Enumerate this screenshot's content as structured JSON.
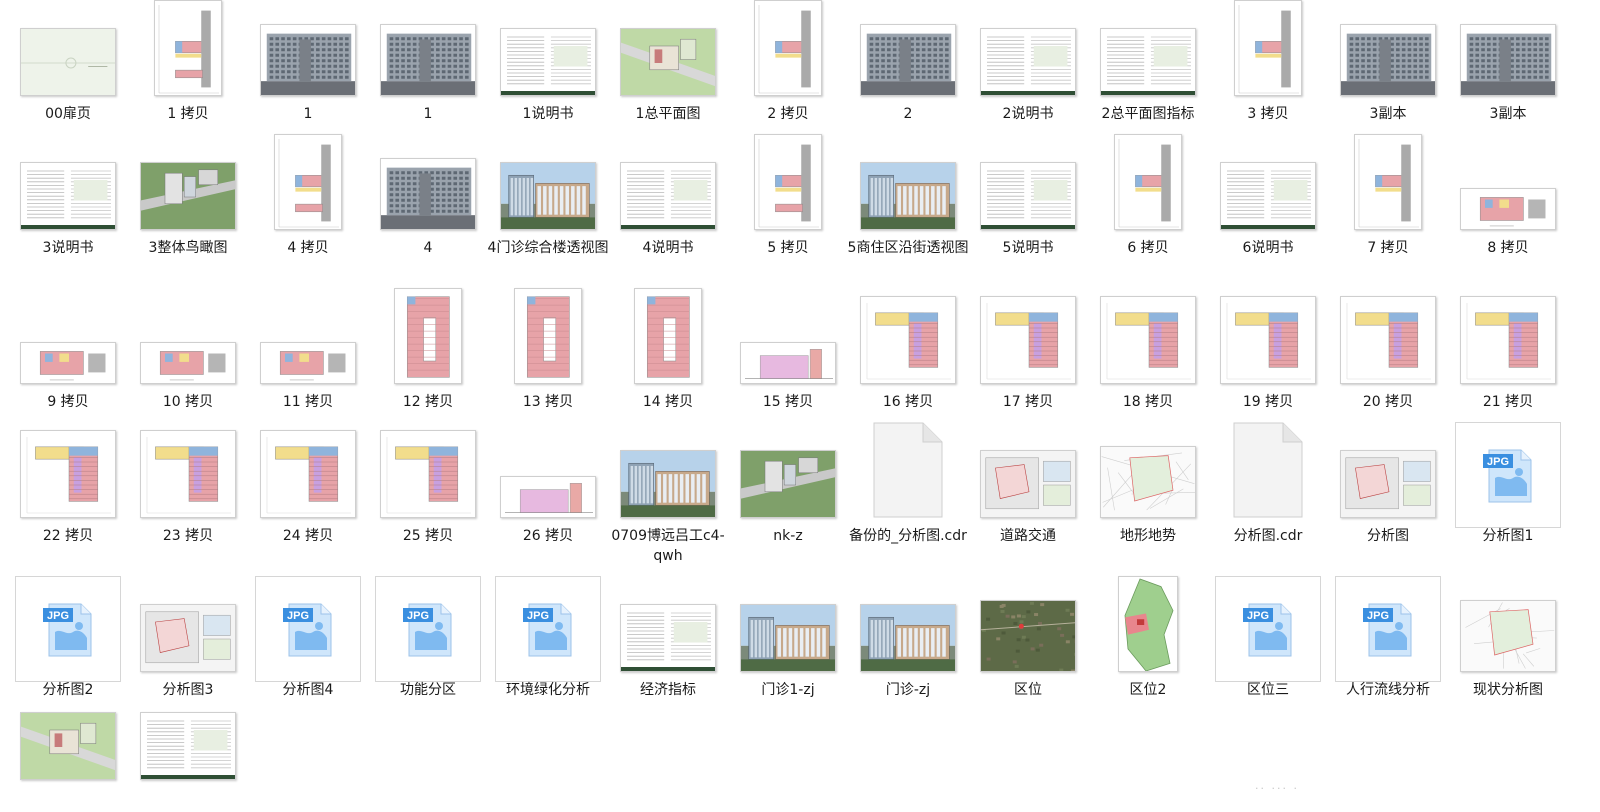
{
  "window": {
    "view": "large-icons"
  },
  "colors": {
    "jpg_blue": "#3a8fe0",
    "jpg_light": "#cfe6fb",
    "plan_pink": "#e7a3a8",
    "plan_yellow": "#f2dd8c",
    "grass": "#a9cf8c",
    "facade_gray": "#6b6f76"
  },
  "files": [
    {
      "label": "00扉页",
      "type": "cover"
    },
    {
      "label": "1 拷贝",
      "type": "plan-portrait"
    },
    {
      "label": "1",
      "type": "elevation"
    },
    {
      "label": "1",
      "type": "elevation"
    },
    {
      "label": "1说明书",
      "type": "doc"
    },
    {
      "label": "1总平面图",
      "type": "siteplan"
    },
    {
      "label": "2 拷贝",
      "type": "plan-portrait"
    },
    {
      "label": "2",
      "type": "elevation"
    },
    {
      "label": "2说明书",
      "type": "doc"
    },
    {
      "label": "2总平面图指标",
      "type": "doc"
    },
    {
      "label": "3 拷贝",
      "type": "plan-portrait"
    },
    {
      "label": "3副本",
      "type": "elevation"
    },
    {
      "label": "3副本",
      "type": "elevation"
    },
    {
      "label": "3说明书",
      "type": "doc"
    },
    {
      "label": "3整体鸟瞰图",
      "type": "aerial"
    },
    {
      "label": "4 拷贝",
      "type": "plan-portrait"
    },
    {
      "label": "4",
      "type": "elevation"
    },
    {
      "label": "4门诊综合楼透视图",
      "type": "render"
    },
    {
      "label": "4说明书",
      "type": "doc"
    },
    {
      "label": "5 拷贝",
      "type": "plan-portrait"
    },
    {
      "label": "5商住区沿街透视图",
      "type": "render"
    },
    {
      "label": "5说明书",
      "type": "doc"
    },
    {
      "label": "6 拷贝",
      "type": "plan-portrait"
    },
    {
      "label": "6说明书",
      "type": "doc"
    },
    {
      "label": "7 拷贝",
      "type": "plan-portrait"
    },
    {
      "label": "8 拷贝",
      "type": "plan-wide"
    },
    {
      "label": "9 拷贝",
      "type": "plan-wide"
    },
    {
      "label": "10 拷贝",
      "type": "plan-wide"
    },
    {
      "label": "11 拷贝",
      "type": "plan-wide"
    },
    {
      "label": "12 拷贝",
      "type": "plan-tall"
    },
    {
      "label": "13 拷贝",
      "type": "plan-tall"
    },
    {
      "label": "14 拷贝",
      "type": "plan-tall"
    },
    {
      "label": "15 拷贝",
      "type": "section"
    },
    {
      "label": "16 拷贝",
      "type": "plan-landscape"
    },
    {
      "label": "17 拷贝",
      "type": "plan-landscape"
    },
    {
      "label": "18 拷贝",
      "type": "plan-landscape"
    },
    {
      "label": "19 拷贝",
      "type": "plan-landscape"
    },
    {
      "label": "20 拷贝",
      "type": "plan-landscape"
    },
    {
      "label": "21 拷贝",
      "type": "plan-landscape"
    },
    {
      "label": "22 拷贝",
      "type": "plan-landscape"
    },
    {
      "label": "23 拷贝",
      "type": "plan-landscape"
    },
    {
      "label": "24 拷贝",
      "type": "plan-landscape"
    },
    {
      "label": "25 拷贝",
      "type": "plan-landscape"
    },
    {
      "label": "26 拷贝",
      "type": "section"
    },
    {
      "label": "0709博远吕工c4-qwh",
      "type": "render"
    },
    {
      "label": "nk-z",
      "type": "aerial"
    },
    {
      "label": "备份的_分析图.cdr",
      "type": "blank-file"
    },
    {
      "label": "道路交通",
      "type": "analysis"
    },
    {
      "label": "地形地势",
      "type": "map-light"
    },
    {
      "label": "分析图.cdr",
      "type": "blank-file"
    },
    {
      "label": "分析图",
      "type": "analysis"
    },
    {
      "label": "分析图1",
      "type": "jpg"
    },
    {
      "label": "分析图2",
      "type": "jpg"
    },
    {
      "label": "分析图3",
      "type": "analysis"
    },
    {
      "label": "分析图4",
      "type": "jpg"
    },
    {
      "label": "功能分区",
      "type": "jpg"
    },
    {
      "label": "环境绿化分析",
      "type": "jpg"
    },
    {
      "label": "经济指标",
      "type": "doc"
    },
    {
      "label": "门诊1-zj",
      "type": "render"
    },
    {
      "label": "门诊-zj",
      "type": "render"
    },
    {
      "label": "区位",
      "type": "satellite"
    },
    {
      "label": "区位2",
      "type": "region-map"
    },
    {
      "label": "区位三",
      "type": "jpg"
    },
    {
      "label": "人行流线分析",
      "type": "jpg"
    },
    {
      "label": "现状分析图",
      "type": "map-light"
    },
    {
      "label": "",
      "type": "siteplan"
    },
    {
      "label": "",
      "type": "doc"
    }
  ],
  "jpg_badge": "JPG",
  "status_watermark": "·· ··· ·"
}
